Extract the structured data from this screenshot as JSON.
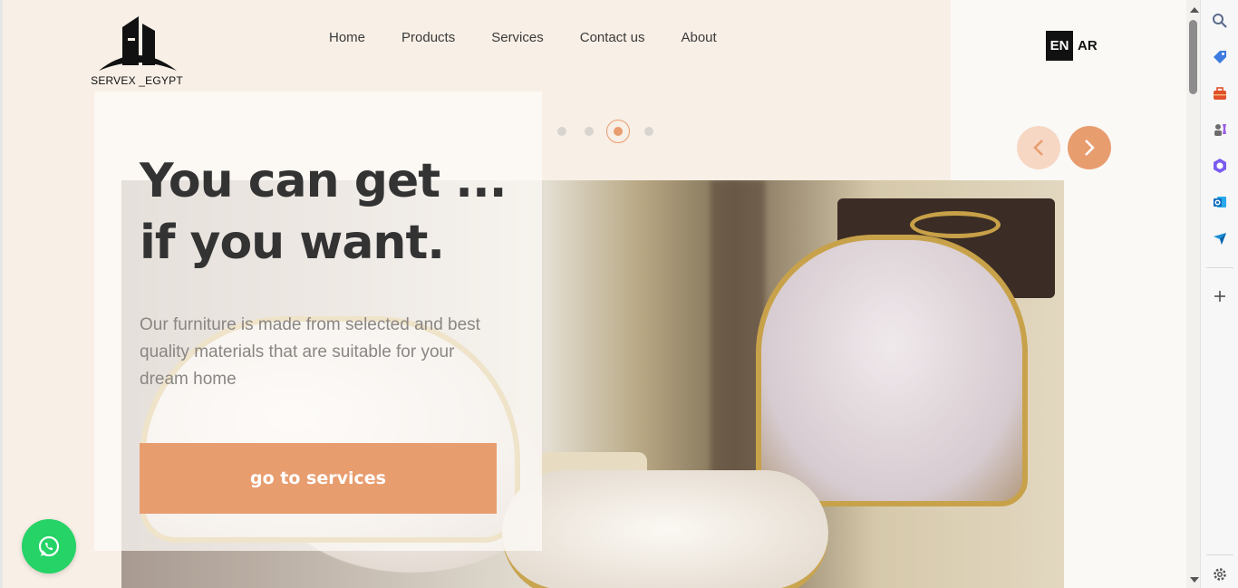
{
  "brand": {
    "name": "SERVEX _EGYPT"
  },
  "nav": {
    "items": [
      {
        "label": "Home"
      },
      {
        "label": "Products"
      },
      {
        "label": "Services"
      },
      {
        "label": "Contact us"
      },
      {
        "label": "About"
      }
    ]
  },
  "language": {
    "en": "EN",
    "ar": "AR",
    "selected": "EN"
  },
  "carousel": {
    "slide_count": 4,
    "active_index": 2
  },
  "hero": {
    "headline_line1": "You can get ...",
    "headline_line2": "if you want.",
    "description": "Our furniture is made from selected and best quality materials that are suitable for your dream home",
    "cta_label": "go to services"
  },
  "colors": {
    "accent": "#e89d6f",
    "accent_light": "#f6d7c4",
    "hero_background": "#f8efe6",
    "whatsapp": "#25d366"
  },
  "sidebar_icons": [
    "search-icon",
    "tag-icon",
    "toolbox-icon",
    "games-icon",
    "copilot-icon",
    "outlook-icon",
    "send-icon",
    "add-icon",
    "settings-icon"
  ]
}
